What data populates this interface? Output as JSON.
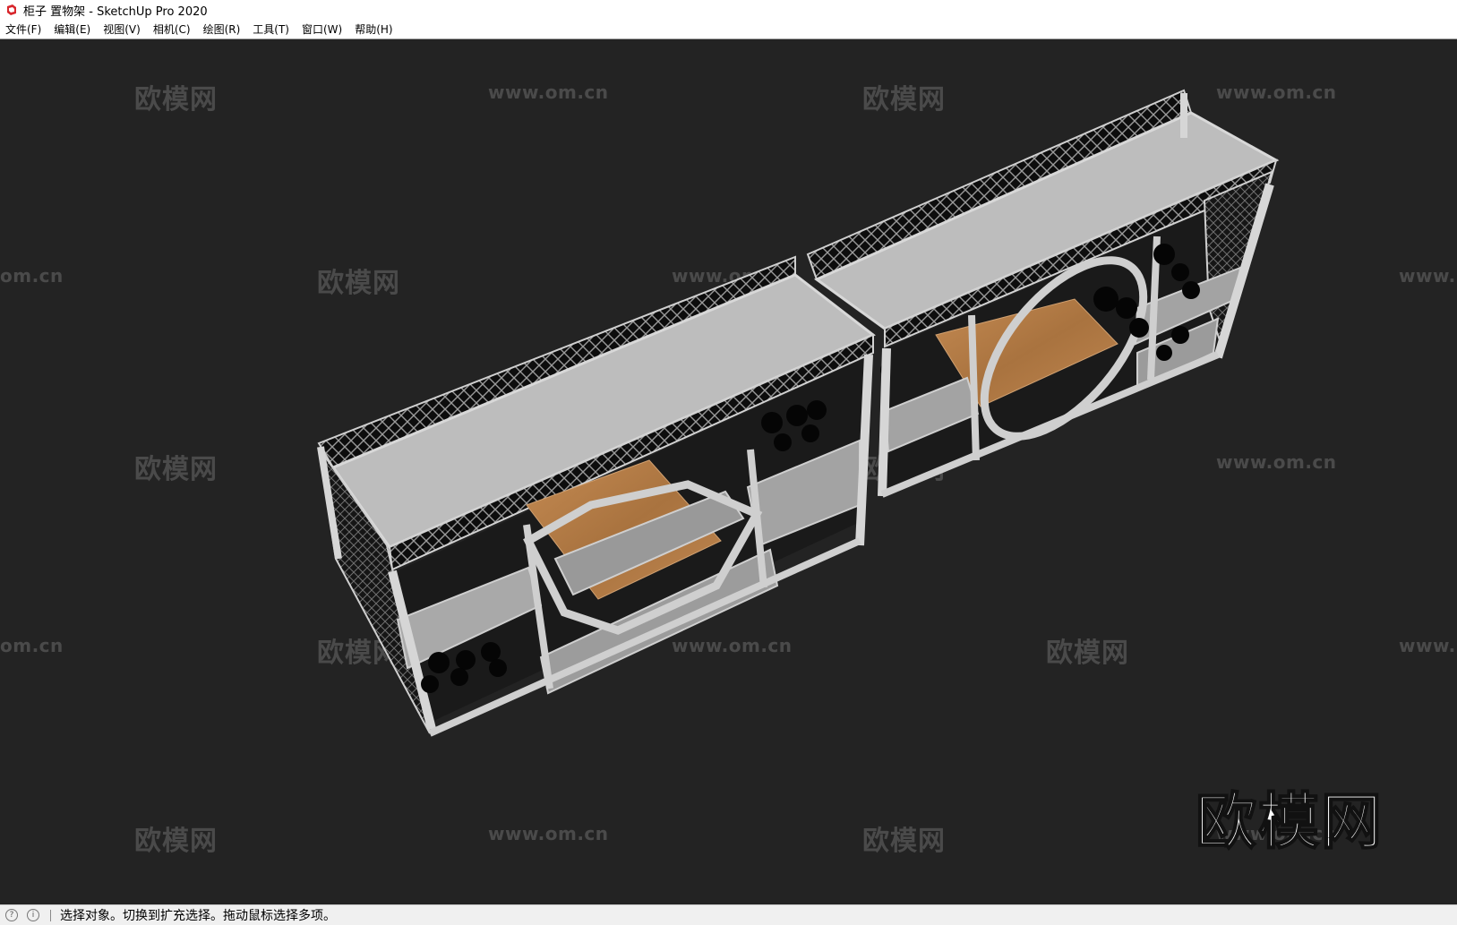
{
  "window": {
    "title": "柜子 置物架 - SketchUp Pro 2020",
    "app_icon": "sketchup-logo-icon"
  },
  "menubar": {
    "items": [
      "文件(F)",
      "编辑(E)",
      "视图(V)",
      "相机(C)",
      "绘图(R)",
      "工具(T)",
      "窗口(W)",
      "帮助(H)"
    ]
  },
  "viewport": {
    "background": "#232323",
    "watermark_text_cn": "欧模网",
    "watermark_text_url": "www.om.cn",
    "watermark_url_partial": "om.cn",
    "watermark_url_partial_right": "www.",
    "logo_text": "欧模网"
  },
  "statusbar": {
    "icons": [
      "location-icon",
      "info-icon"
    ],
    "message": "选择对象。切换到扩充选择。拖动鼠标选择多项。"
  },
  "colors": {
    "frame": "#c8c8c8",
    "shelf_top": "#bdbdbd",
    "wood": "#b07a44",
    "lattice": "#111111"
  }
}
